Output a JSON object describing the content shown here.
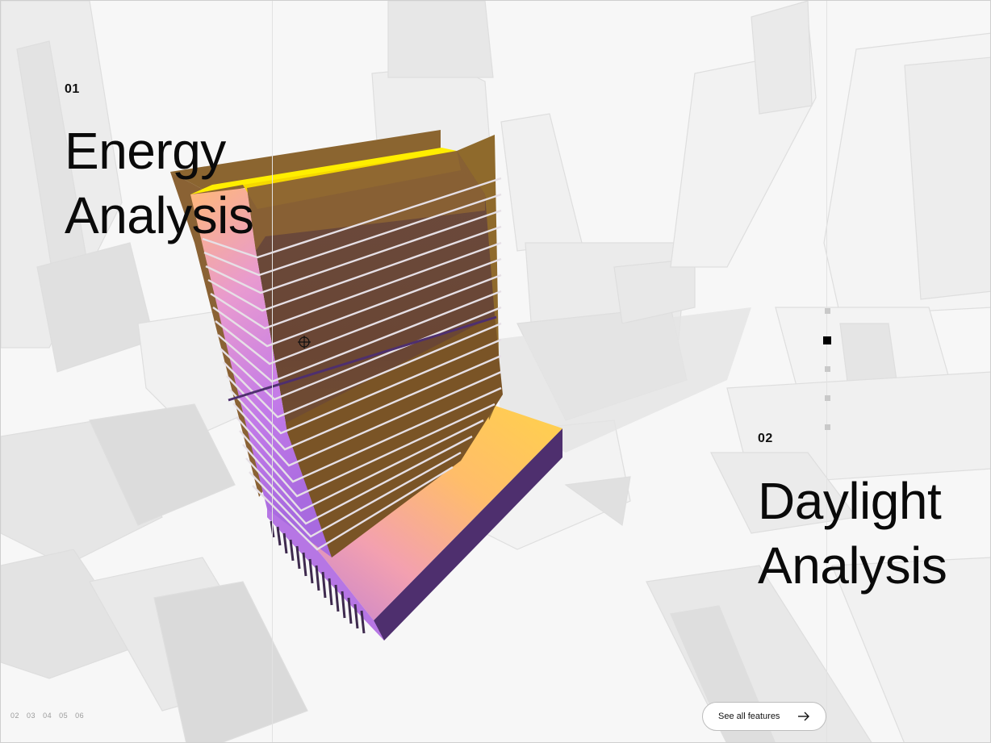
{
  "sections": [
    {
      "number": "01",
      "title_line1": "Energy",
      "title_line2": "Analysis"
    },
    {
      "number": "02",
      "title_line1": "Daylight",
      "title_line2": "Analysis"
    }
  ],
  "pager": {
    "items": [
      "02",
      "03",
      "04",
      "05",
      "06"
    ]
  },
  "side_nav": {
    "count": 5,
    "active_index": 1
  },
  "features_button": {
    "label": "See all features",
    "icon": "arrow-right-icon"
  },
  "cursor": {
    "icon": "crosshair-icon"
  },
  "colors": {
    "background": "#f7f7f7",
    "accent_yellow": "#ffee00",
    "facade_brown": "#7a5230",
    "gradient_orange": "#ffc25e",
    "gradient_violet": "#b56cd8",
    "podium_purple": "#4e2f6e"
  }
}
